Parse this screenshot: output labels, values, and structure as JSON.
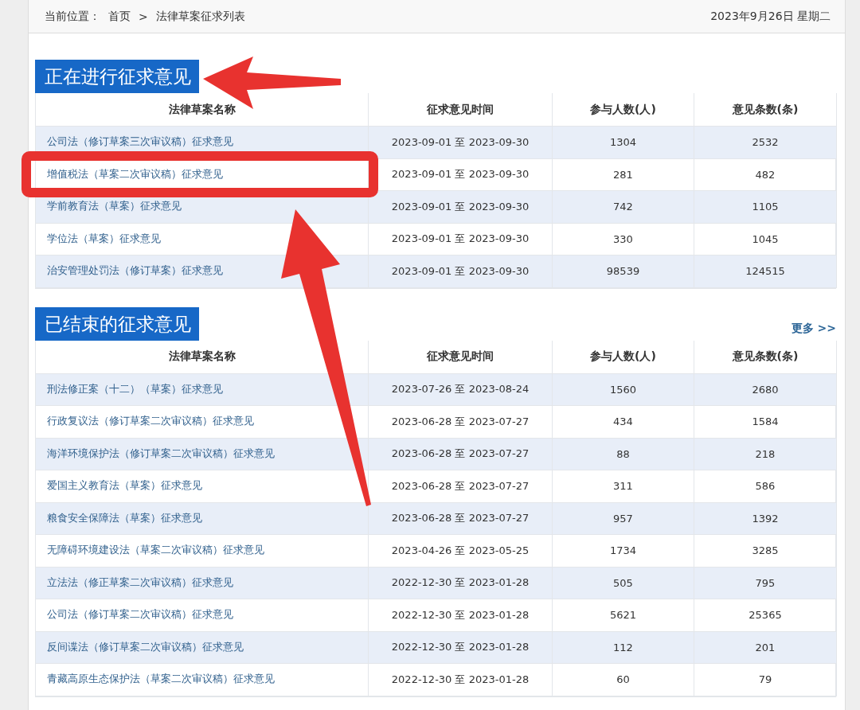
{
  "breadcrumb": {
    "label": "当前位置：",
    "items": [
      "首页",
      "法律草案征求列表"
    ],
    "separator": ">"
  },
  "date": "2023年9月26日 星期二",
  "sections": [
    {
      "title": "正在进行征求意见",
      "marked": true,
      "columns": [
        "法律草案名称",
        "征求意见时间",
        "参与人数(人)",
        "意见条数(条)"
      ],
      "rows": [
        {
          "name": "公司法（修订草案三次审议稿）征求意见",
          "period": "2023-09-01 至 2023-09-30",
          "participants": "1304",
          "comments": "2532",
          "highlighted": false
        },
        {
          "name": "增值税法（草案二次审议稿）征求意见",
          "period": "2023-09-01 至 2023-09-30",
          "participants": "281",
          "comments": "482",
          "highlighted": true
        },
        {
          "name": "学前教育法（草案）征求意见",
          "period": "2023-09-01 至 2023-09-30",
          "participants": "742",
          "comments": "1105",
          "highlighted": false
        },
        {
          "name": "学位法（草案）征求意见",
          "period": "2023-09-01 至 2023-09-30",
          "participants": "330",
          "comments": "1045",
          "highlighted": false
        },
        {
          "name": "治安管理处罚法（修订草案）征求意见",
          "period": "2023-09-01 至 2023-09-30",
          "participants": "98539",
          "comments": "124515",
          "highlighted": false
        }
      ]
    },
    {
      "title": "已结束的征求意见",
      "marked": false,
      "more": "更多 >>",
      "columns": [
        "法律草案名称",
        "征求意见时间",
        "参与人数(人)",
        "意见条数(条)"
      ],
      "rows": [
        {
          "name": "刑法修正案（十二）（草案）征求意见",
          "period": "2023-07-26 至 2023-08-24",
          "participants": "1560",
          "comments": "2680",
          "highlighted": false
        },
        {
          "name": "行政复议法（修订草案二次审议稿）征求意见",
          "period": "2023-06-28 至 2023-07-27",
          "participants": "434",
          "comments": "1584",
          "highlighted": false
        },
        {
          "name": "海洋环境保护法（修订草案二次审议稿）征求意见",
          "period": "2023-06-28 至 2023-07-27",
          "participants": "88",
          "comments": "218",
          "highlighted": false
        },
        {
          "name": "爱国主义教育法（草案）征求意见",
          "period": "2023-06-28 至 2023-07-27",
          "participants": "311",
          "comments": "586",
          "highlighted": false
        },
        {
          "name": "粮食安全保障法（草案）征求意见",
          "period": "2023-06-28 至 2023-07-27",
          "participants": "957",
          "comments": "1392",
          "highlighted": false
        },
        {
          "name": "无障碍环境建设法（草案二次审议稿）征求意见",
          "period": "2023-04-26 至 2023-05-25",
          "participants": "1734",
          "comments": "3285",
          "highlighted": false
        },
        {
          "name": "立法法（修正草案二次审议稿）征求意见",
          "period": "2022-12-30 至 2023-01-28",
          "participants": "505",
          "comments": "795",
          "highlighted": false
        },
        {
          "name": "公司法（修订草案二次审议稿）征求意见",
          "period": "2022-12-30 至 2023-01-28",
          "participants": "5621",
          "comments": "25365",
          "highlighted": false
        },
        {
          "name": "反间谍法（修订草案二次审议稿）征求意见",
          "period": "2022-12-30 至 2023-01-28",
          "participants": "112",
          "comments": "201",
          "highlighted": false
        },
        {
          "name": "青藏高原生态保护法（草案二次审议稿）征求意见",
          "period": "2022-12-30 至 2023-01-28",
          "participants": "60",
          "comments": "79",
          "highlighted": false
        }
      ]
    }
  ]
}
